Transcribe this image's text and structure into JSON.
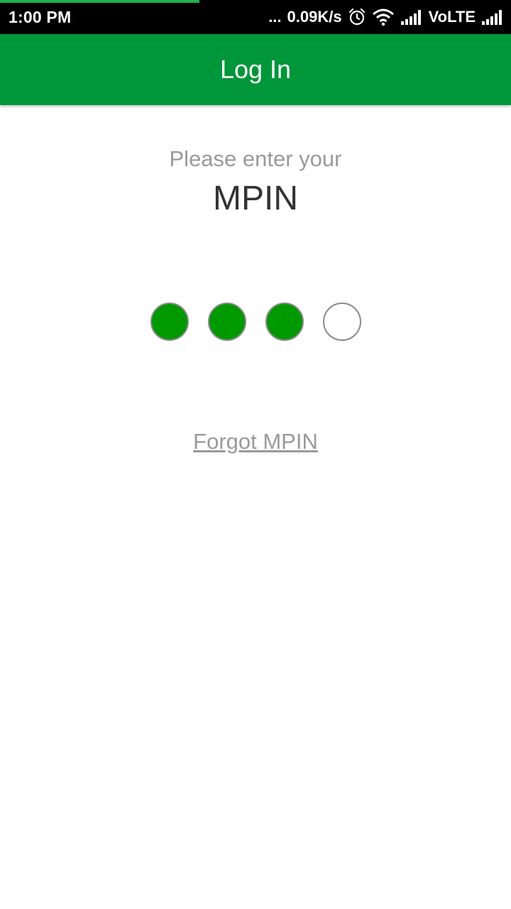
{
  "status_bar": {
    "time": "1:00 PM",
    "dots": "...",
    "network_speed": "0.09K/s",
    "carrier_label": "VoLTE",
    "icons": [
      "alarm-icon",
      "wifi-icon",
      "signal-icon",
      "signal-icon"
    ],
    "progress_fraction": 0.39,
    "progress_color": "#22b14c"
  },
  "app_bar": {
    "title": "Log In",
    "background": "#00963a"
  },
  "prompt": {
    "line1": "Please enter your",
    "line2": "MPIN"
  },
  "pin": {
    "length": 4,
    "entered": 3,
    "filled_color": "#009900"
  },
  "forgot_link": "Forgot MPIN"
}
